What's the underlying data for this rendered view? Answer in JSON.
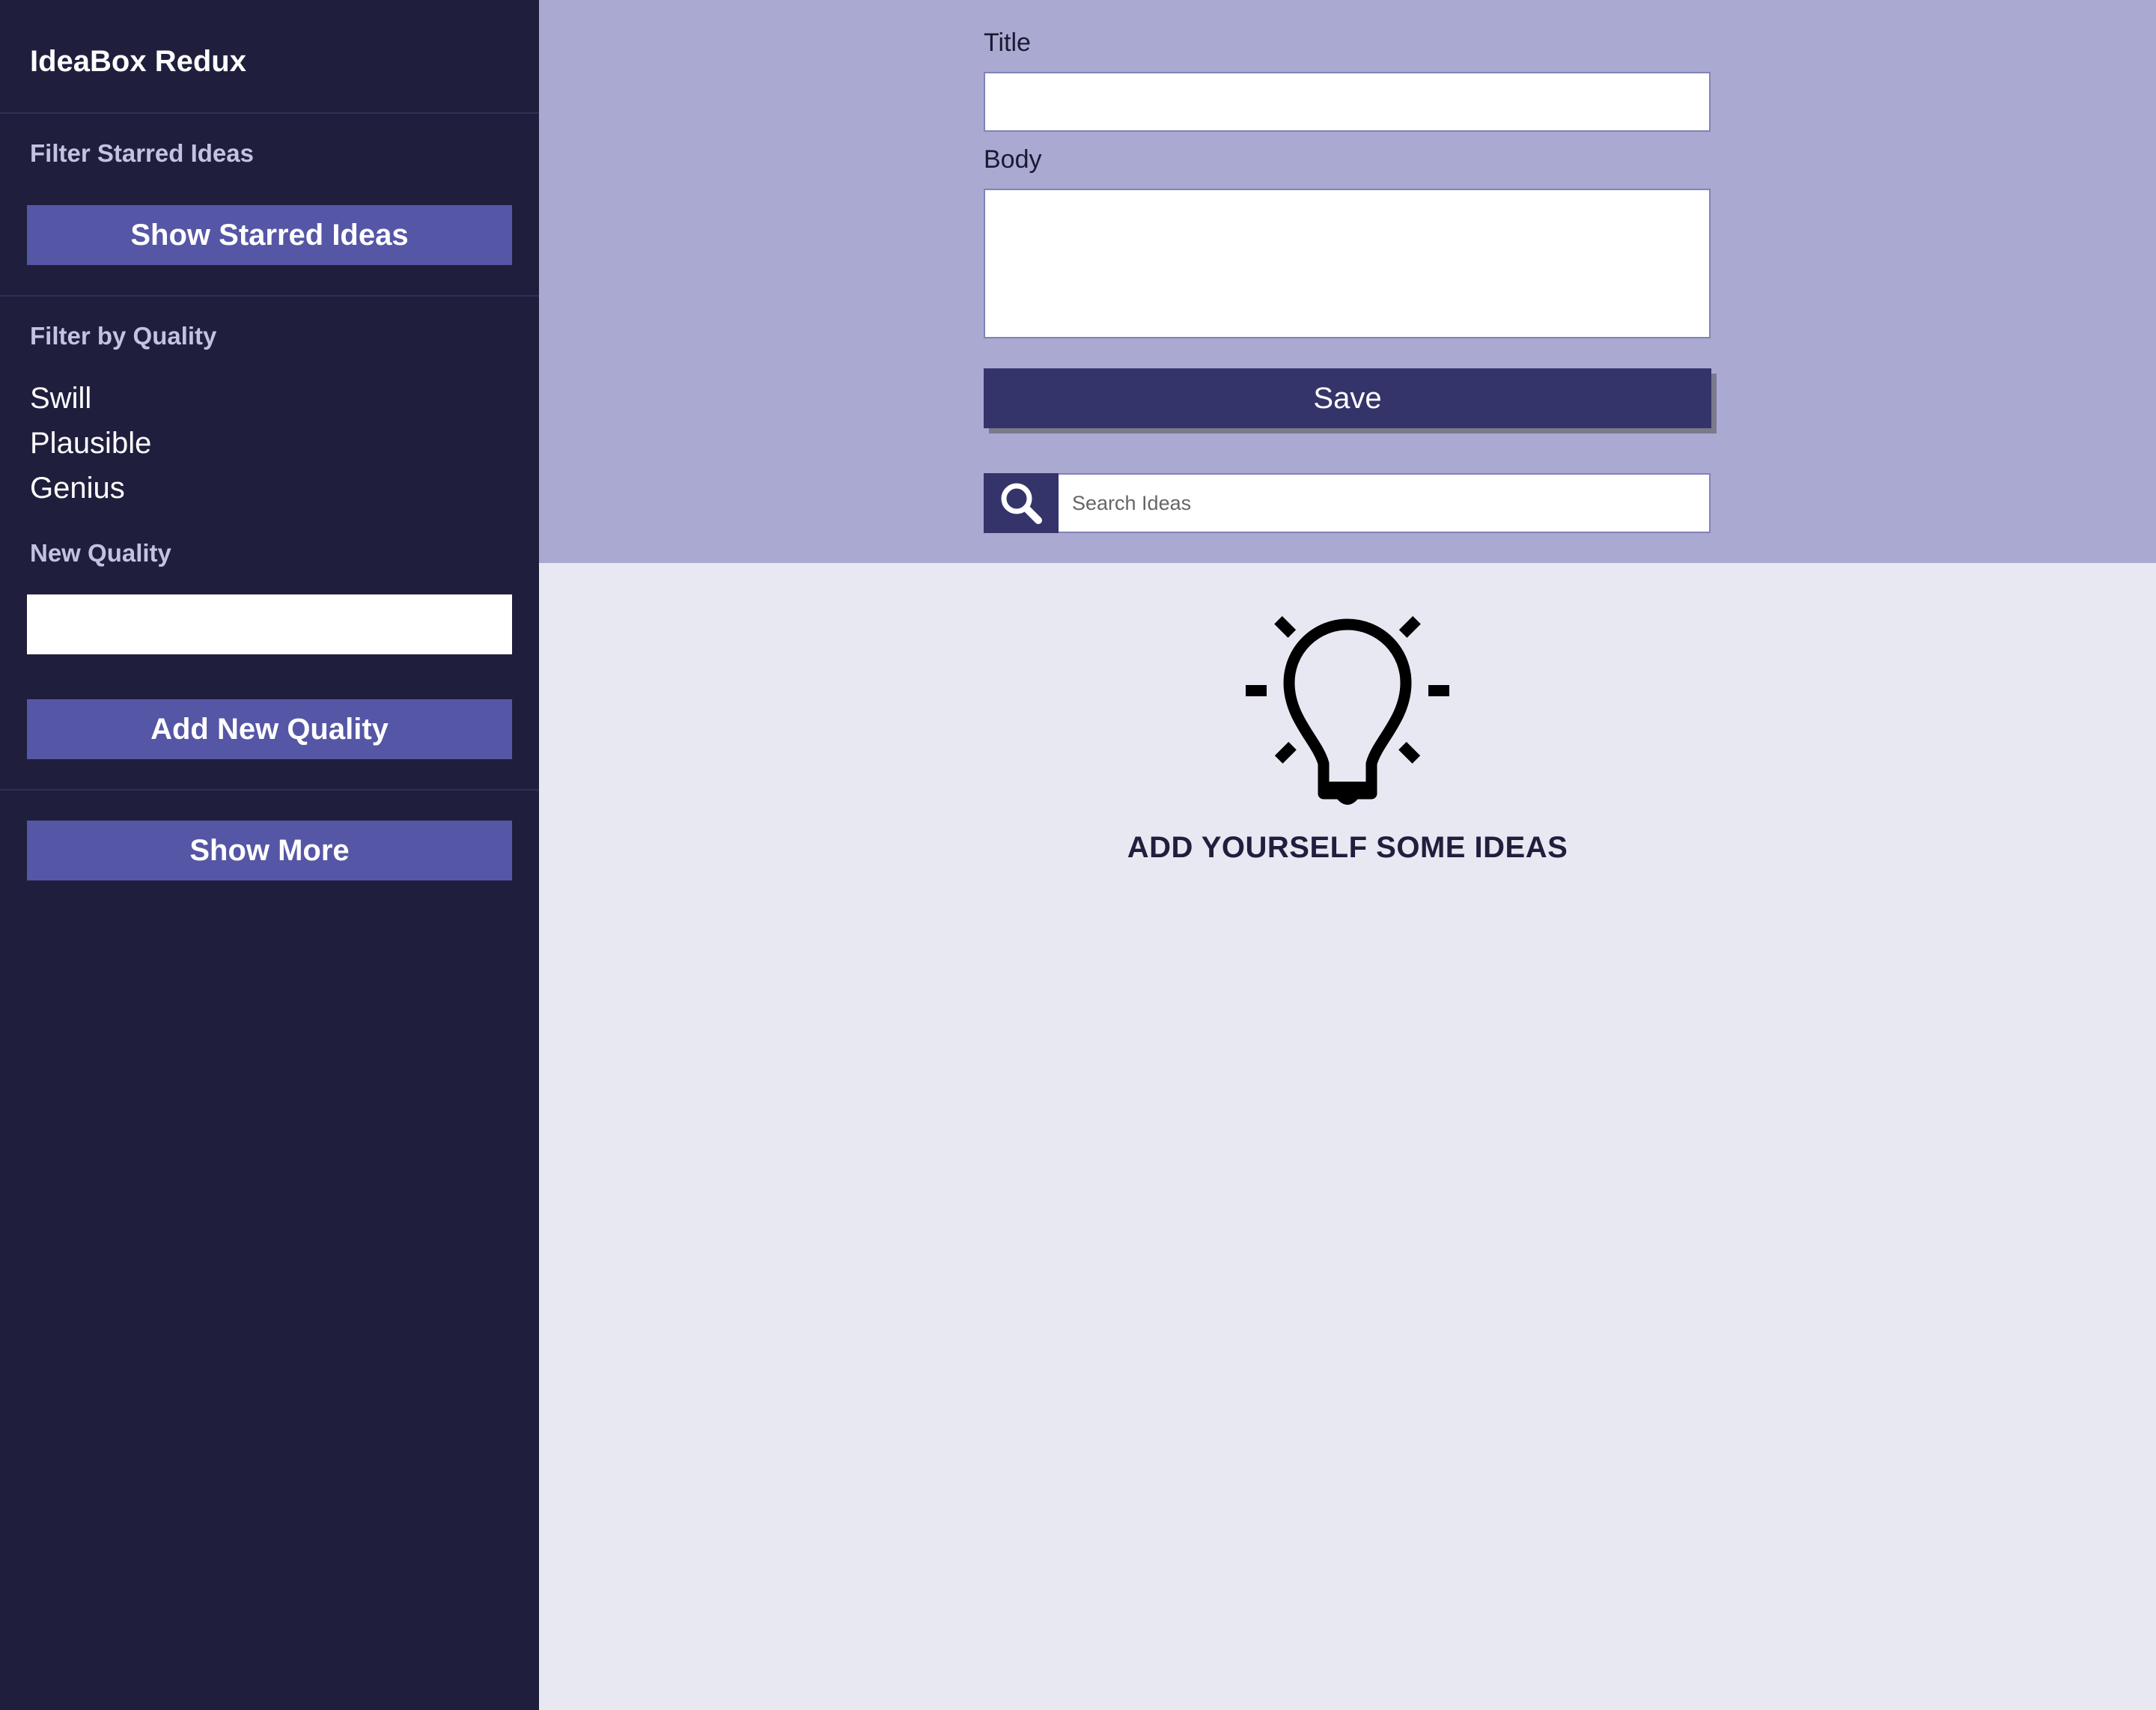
{
  "sidebar": {
    "app_title": "IdeaBox Redux",
    "filter_starred_label": "Filter Starred Ideas",
    "show_starred_button": "Show Starred Ideas",
    "filter_quality_label": "Filter by Quality",
    "qualities": [
      "Swill",
      "Plausible",
      "Genius"
    ],
    "new_quality_label": "New Quality",
    "new_quality_value": "",
    "add_quality_button": "Add New Quality",
    "show_more_button": "Show More"
  },
  "form": {
    "title_label": "Title",
    "title_value": "",
    "body_label": "Body",
    "body_value": "",
    "save_button": "Save"
  },
  "search": {
    "placeholder": "Search Ideas",
    "icon": "search-icon"
  },
  "empty_state": {
    "icon": "lightbulb-icon",
    "message": "ADD YOURSELF SOME IDEAS"
  },
  "colors": {
    "sidebar_bg": "#1f1f3d",
    "accent_button": "#5656a6",
    "form_bg": "#a9a9d2",
    "save_button": "#34346a",
    "main_bg": "#e8e8f3"
  }
}
